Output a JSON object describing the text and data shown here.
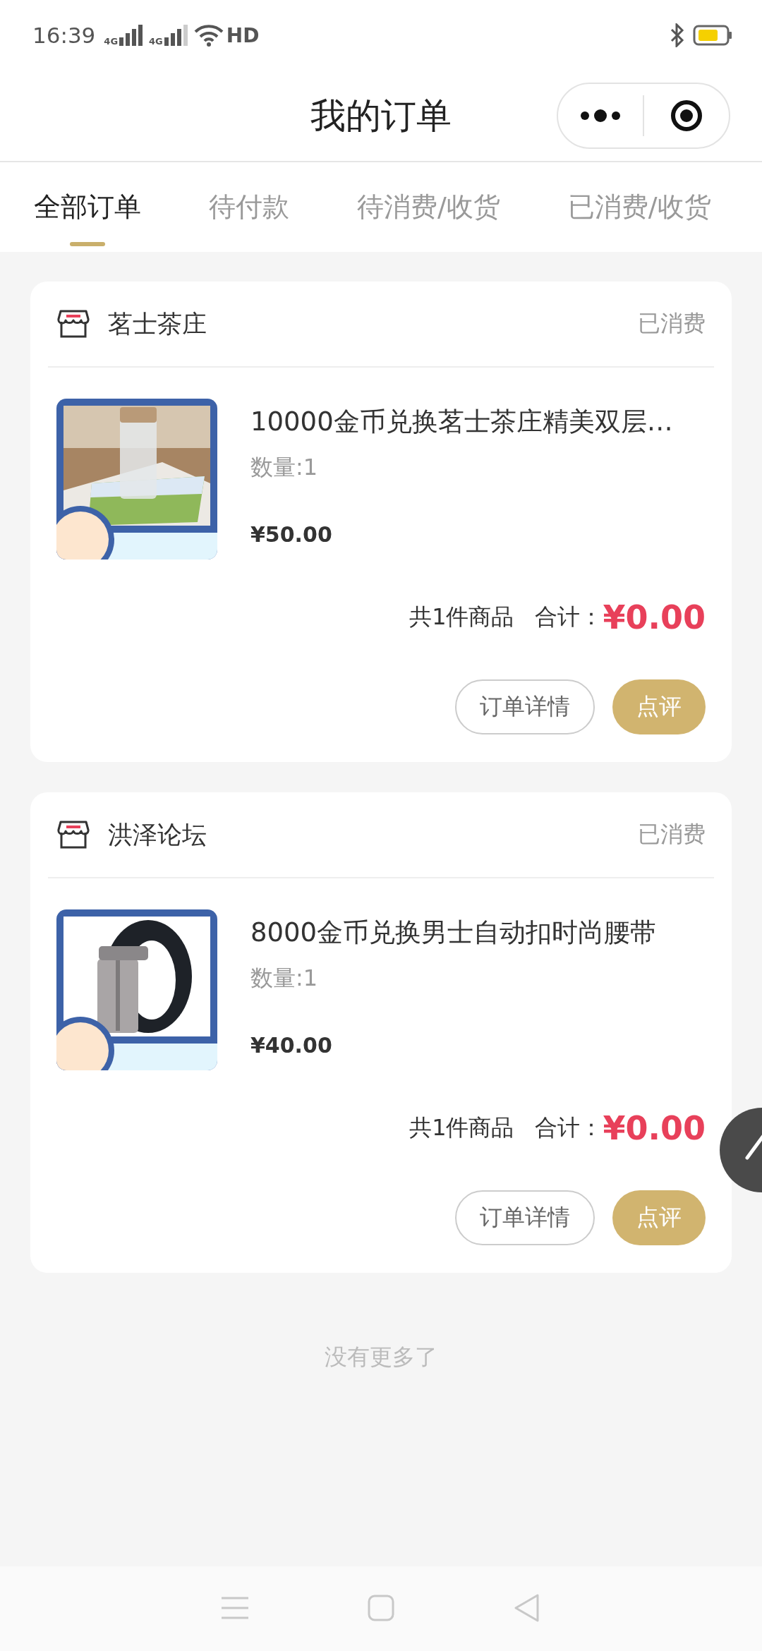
{
  "status_bar": {
    "time": "16:39",
    "signal_labels": [
      "4G",
      "4G"
    ],
    "hd_label": "HD"
  },
  "header": {
    "title": "我的订单"
  },
  "tabs": [
    {
      "label": "全部订单",
      "selected": true
    },
    {
      "label": "待付款",
      "selected": false
    },
    {
      "label": "待消费/收货",
      "selected": false
    },
    {
      "label": "已消费/收货",
      "selected": false
    }
  ],
  "orders": [
    {
      "shop": "茗士茶庄",
      "status": "已消费",
      "item": {
        "title": "10000金币兑换茗士茶庄精美双层…",
        "quantity": "数量:1",
        "price": "¥50.00"
      },
      "summary": {
        "count": "共1件商品",
        "total_label": "合计：",
        "total": "¥0.00"
      },
      "buttons": [
        {
          "label": "订单详情",
          "kind": "outline"
        },
        {
          "label": "点评",
          "kind": "primary"
        }
      ]
    },
    {
      "shop": "洪泽论坛",
      "status": "已消费",
      "item": {
        "title": "8000金币兑换男士自动扣时尚腰带",
        "quantity": "数量:1",
        "price": "¥40.00"
      },
      "summary": {
        "count": "共1件商品",
        "total_label": "合计：",
        "total": "¥0.00"
      },
      "buttons": [
        {
          "label": "订单详情",
          "kind": "outline"
        },
        {
          "label": "点评",
          "kind": "primary"
        }
      ]
    }
  ],
  "footer": {
    "text": "没有更多了"
  }
}
